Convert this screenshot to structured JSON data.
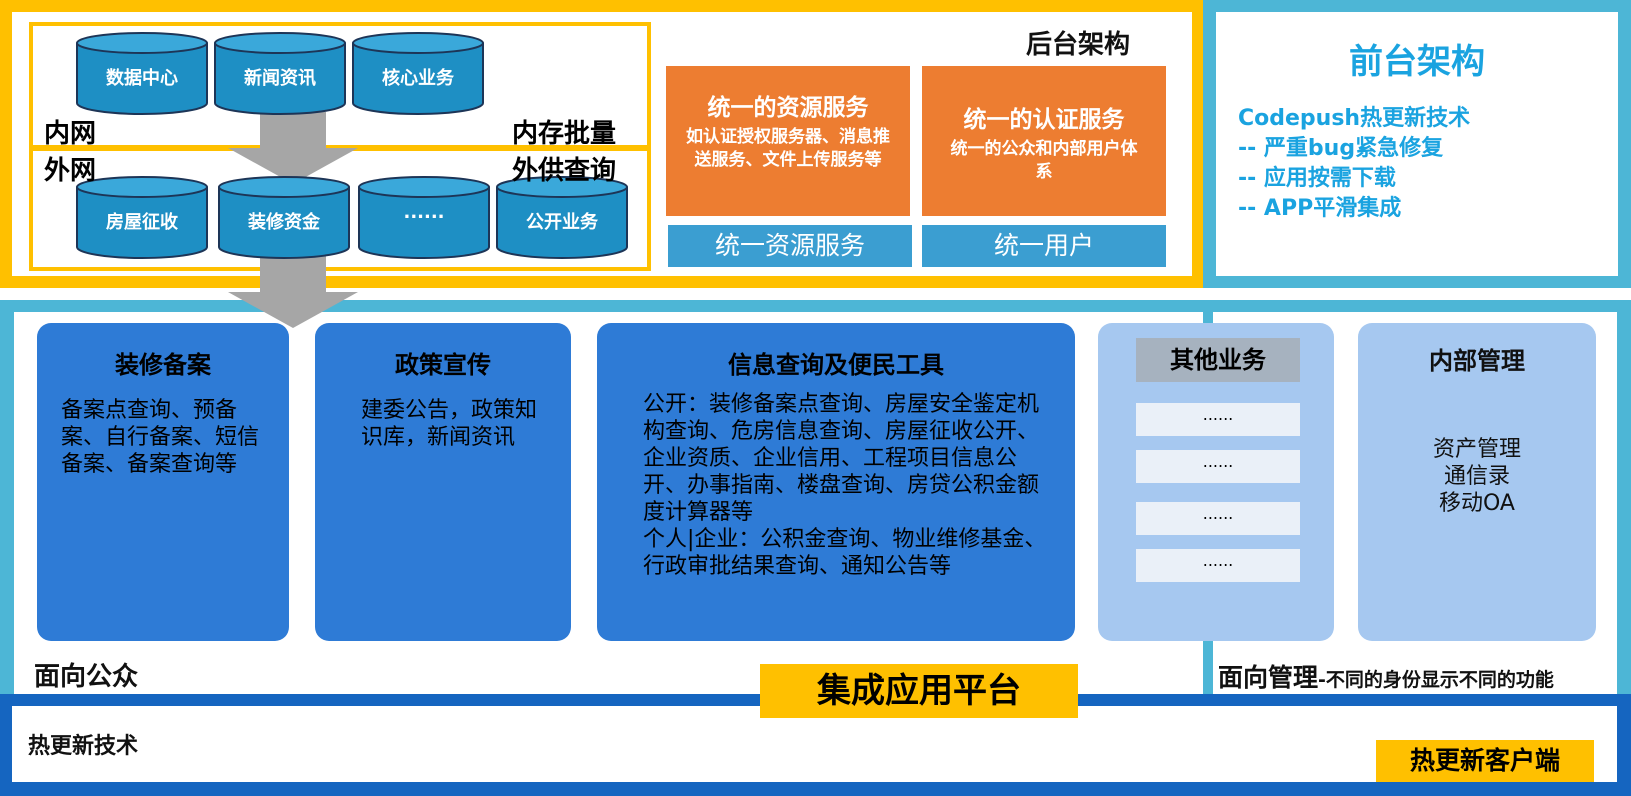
{
  "backend": {
    "title": "后台架构",
    "intranet_label": "内网",
    "extranet_label": "外网",
    "memory_batch_label": "内存批量",
    "external_query_label": "外供查询",
    "internal_dbs": [
      "数据中心",
      "新闻资讯",
      "核心业务"
    ],
    "external_dbs": [
      "房屋征收",
      "装修资金",
      "......",
      "公开业务"
    ],
    "resource_service": {
      "title": "统一的资源服务",
      "desc": "如认证授权服务器、消息推送服务、文件上传服务等",
      "bar": "统一资源服务"
    },
    "auth_service": {
      "title": "统一的认证服务",
      "desc": "统一的公众和内部用户体系",
      "bar": "统一用户"
    }
  },
  "frontend": {
    "title": "前台架构",
    "lines": [
      "Codepush热更新技术",
      "-- 严重bug紧急修复",
      "-- 应用按需下载",
      "-- APP平滑集成"
    ]
  },
  "platform": {
    "cards": [
      {
        "title": "装修备案",
        "body": "备案点查询、预备案、自行备案、短信备案、备案查询等"
      },
      {
        "title": "政策宣传",
        "body": "建委公告，政策知识库，新闻资讯"
      },
      {
        "title": "信息查询及便民工具",
        "body": "公开：装修备案点查询、房屋安全鉴定机构查询、危房信息查询、房屋征收公开、企业资质、企业信用、工程项目信息公开、办事指南、楼盘查询、房贷公积金额度计算器等\n个人|企业：公积金查询、物业维修基金、行政审批结果查询、通知公告等"
      }
    ],
    "other": {
      "title": "其他业务",
      "items": [
        "......",
        "......",
        "......",
        "......"
      ]
    },
    "internal": {
      "title": "内部管理",
      "items": [
        "资产管理",
        "通信录",
        "移动OA"
      ]
    },
    "public_label": "面向公众",
    "platform_label": "集成应用平台",
    "manage_label": "面向管理",
    "manage_note": "-不同的身份显示不同的功能"
  },
  "client": {
    "left_label": "热更新技术",
    "right_label": "热更新客户端"
  },
  "colors": {
    "gold": "#ffc000",
    "cyan": "#4db6d6",
    "orange": "#ed7d31",
    "card_blue": "#2e7bd6",
    "pale_blue": "#a6c8f0",
    "dark_blue": "#1565c0",
    "accent_text": "#1aa3e0"
  }
}
